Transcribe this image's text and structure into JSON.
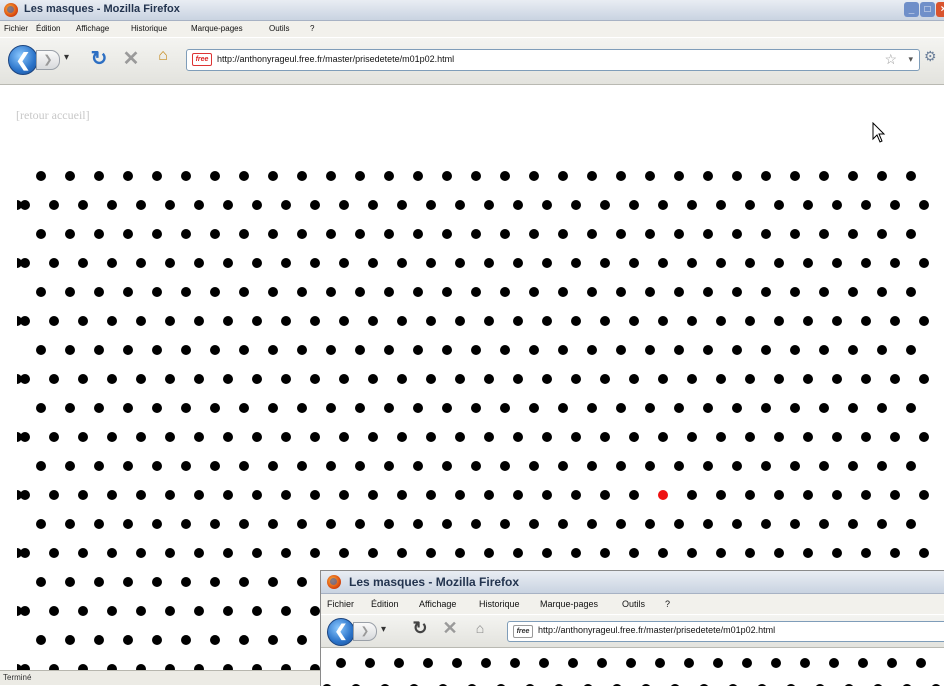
{
  "window": {
    "title": "Les masques - Mozilla Firefox",
    "menu": [
      "Fichier",
      "Édition",
      "Affichage",
      "Historique",
      "Marque-pages",
      "Outils",
      "?"
    ],
    "url": "http://anthonyrageul.free.fr/master/prisedetete/m01p02.html",
    "favicon_text": "free",
    "page": {
      "back_link": "[retour accueil]",
      "dot_rows": 18,
      "highlighted_dot": {
        "row": 12,
        "column": 23,
        "color": "#ee1111"
      }
    },
    "status_text": "Terminé"
  },
  "overlay_window": {
    "title": "Les masques - Mozilla Firefox",
    "menu": [
      "Fichier",
      "Édition",
      "Affichage",
      "Historique",
      "Marque-pages",
      "Outils",
      "?"
    ],
    "url": "http://anthonyrageul.free.fr/master/prisedetete/m01p02.html",
    "favicon_text": "free"
  },
  "colors": {
    "dot": "#000000",
    "highlight": "#ee1111",
    "titlebar": "#c9d3e1"
  }
}
